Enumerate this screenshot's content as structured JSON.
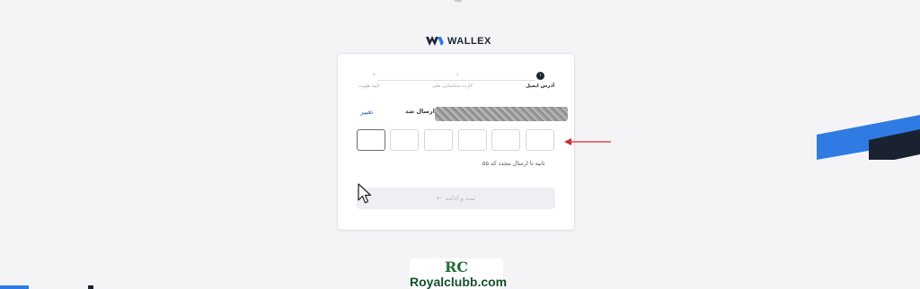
{
  "brand": {
    "name": "WALLEX"
  },
  "stepper": [
    {
      "number": "۱",
      "label": "آدرس ایمیل",
      "state": "active"
    },
    {
      "number": "۲",
      "label": "کارت شناسایی ملی",
      "state": "pending"
    },
    {
      "number": "۳",
      "label": "تایید هویت",
      "state": "pending"
    }
  ],
  "sent": {
    "label": "ارسال شد:",
    "change_link": "تغییر"
  },
  "otp": {
    "count": 6,
    "active_index": 5
  },
  "timer": {
    "text": "۵۵ ثانیه تا ارسال مجدد کد"
  },
  "submit": {
    "label": "ثبت و ادامه",
    "icon": "arrow-left-icon",
    "enabled": false
  },
  "watermark": {
    "logo": "RC",
    "text": "Royalclubb.com"
  },
  "colors": {
    "accent_blue": "#2f7be3",
    "annotation_red": "#d62b2b",
    "link": "#3464b0"
  }
}
